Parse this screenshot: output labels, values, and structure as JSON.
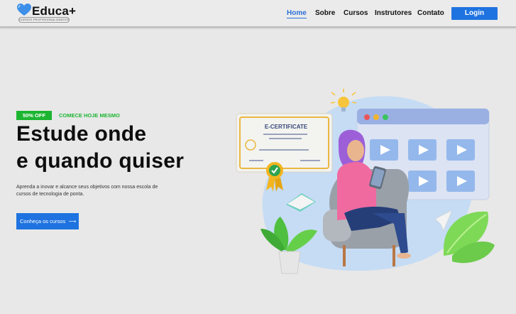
{
  "brand": {
    "name": "Educa+",
    "tagline": "CURSOS PROFISSIONALIZANTES",
    "accent": "#2b6fd8"
  },
  "nav": {
    "items": [
      {
        "label": "Home",
        "active": true
      },
      {
        "label": "Sobre",
        "active": false
      },
      {
        "label": "Cursos",
        "active": false
      },
      {
        "label": "Instrutores",
        "active": false
      },
      {
        "label": "Contato",
        "active": false
      }
    ],
    "login_label": "Login"
  },
  "hero": {
    "badge": "50% OFF",
    "badge_color": "#1cb531",
    "promo": "COMECE HOJE MESMO",
    "title_line1": "Estude onde",
    "title_line2": "e quando quiser",
    "description": "Aprenda a inovar e alcance seus objetivos com nossa escola de cursos de tecnologia de ponta.",
    "cta_label": "Conheça os cursos",
    "cta_icon": "arrow-right-icon"
  },
  "illustration": {
    "certificate_title": "E-CERTIFICATE"
  }
}
